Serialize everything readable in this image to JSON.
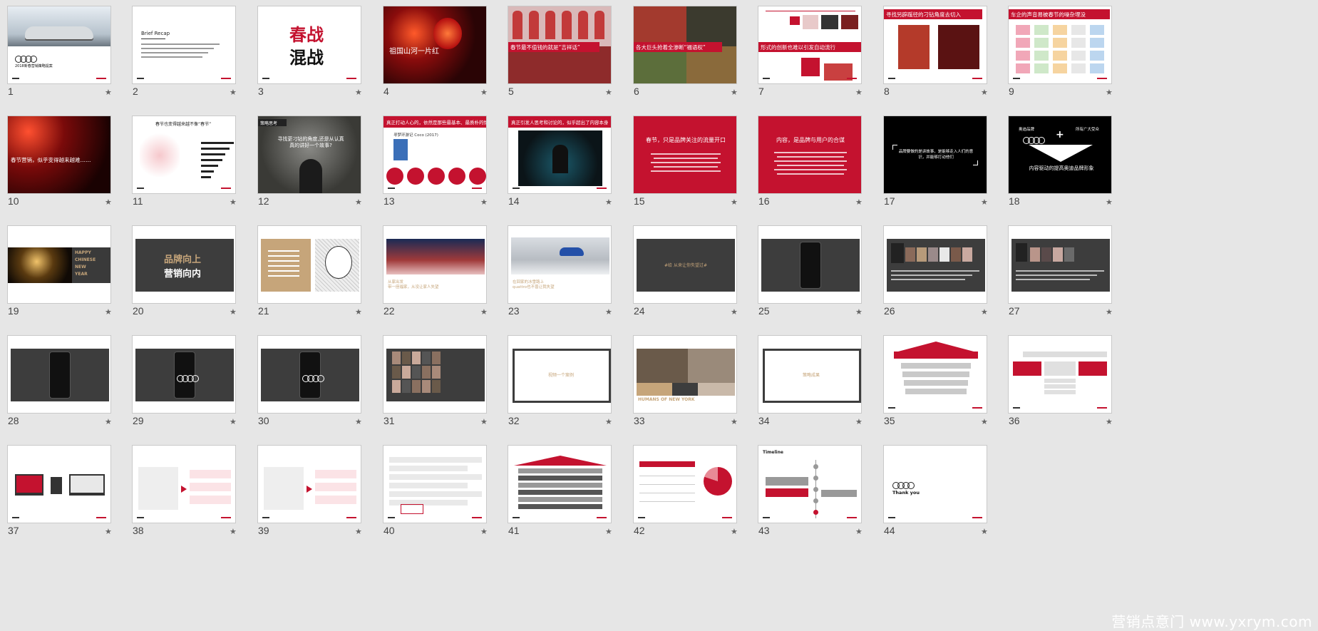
{
  "slides": [
    {
      "n": "1"
    },
    {
      "n": "2"
    },
    {
      "n": "3"
    },
    {
      "n": "4"
    },
    {
      "n": "5"
    },
    {
      "n": "6"
    },
    {
      "n": "7"
    },
    {
      "n": "8"
    },
    {
      "n": "9"
    },
    {
      "n": "10"
    },
    {
      "n": "11"
    },
    {
      "n": "12"
    },
    {
      "n": "13"
    },
    {
      "n": "14"
    },
    {
      "n": "15"
    },
    {
      "n": "16"
    },
    {
      "n": "17"
    },
    {
      "n": "18"
    },
    {
      "n": "19"
    },
    {
      "n": "20"
    },
    {
      "n": "21"
    },
    {
      "n": "22"
    },
    {
      "n": "23"
    },
    {
      "n": "24"
    },
    {
      "n": "25"
    },
    {
      "n": "26"
    },
    {
      "n": "27"
    },
    {
      "n": "28"
    },
    {
      "n": "29"
    },
    {
      "n": "30"
    },
    {
      "n": "31"
    },
    {
      "n": "32"
    },
    {
      "n": "33"
    },
    {
      "n": "34"
    },
    {
      "n": "35"
    },
    {
      "n": "36"
    },
    {
      "n": "37"
    },
    {
      "n": "38"
    },
    {
      "n": "39"
    },
    {
      "n": "40"
    },
    {
      "n": "41"
    },
    {
      "n": "42"
    },
    {
      "n": "43"
    },
    {
      "n": "44"
    }
  ],
  "star": "★",
  "text": {
    "s1_title": "2018新春营销策略提案",
    "s2_title": "Brief Recap",
    "s3_line1": "春战",
    "s3_line2": "混战",
    "s4_caption": "祖国山河一片红",
    "s5_caption": "春节最不值钱的就是“吉祥话”",
    "s6_caption": "各大巨头抢着全渗断“福语权”",
    "s7_caption": "形式的创新也难以引发自动流行",
    "s8_caption": "寻找另辟蹊径的刁钻角度去切入",
    "s9_caption": "车企的声音易被春节的噪杂埋没",
    "s10_caption": "春节营销，似乎变得越来越难……",
    "s11_title": "春节也变得越来越不像“春节”",
    "s12_tag": "策略思考",
    "s12_line": "寻找更刁钻的角度,还是从认真真的讲好一个故事?",
    "s13_title": "真正打动人心的，依然是那些最基本、最质朴的情感",
    "s13_sub": "寻梦环游记 Coco (2017)",
    "s14_title": "真正引发人思考和讨论的，似乎超出了内容本身",
    "s15_title": "春节，只是品牌关注的流量开口",
    "s16_title": "内容，是品牌与用户的合谋",
    "s17_line": "品牌要做的是讲故事，是能够走入人们的意识，并能够打动他们",
    "s18_brand": "奥迪品牌",
    "s18_plus": "+",
    "s18_right": "所有广大受众",
    "s18_bottom": "内容驱动的提高奥迪品牌形象",
    "s19_l1": "HAPPY",
    "s19_l2": "CHINESE",
    "s19_l3": "NEW",
    "s19_l4": "YEAR",
    "s20_line1": "品牌向上",
    "s20_line2": "营销向内",
    "s22_caption": "从家出发\n带一座福家，从没让家人失望",
    "s23_caption": "在回家的冰雪路上\nquattro也不曾让我失望",
    "s24_caption": "#给 从来让你失望过#",
    "s32_caption": "视频一个案例",
    "s33_caption": "HUMANS OF NEW YORK",
    "s34_caption": "策略成果",
    "s43_title": "Timeline",
    "s44_thanks": "Thank you"
  },
  "watermark": "营销点意门 www.yxrym.com",
  "colors": {
    "accent": "#c4122f",
    "dark": "#3d3d3d",
    "tan": "#c6a57a"
  }
}
